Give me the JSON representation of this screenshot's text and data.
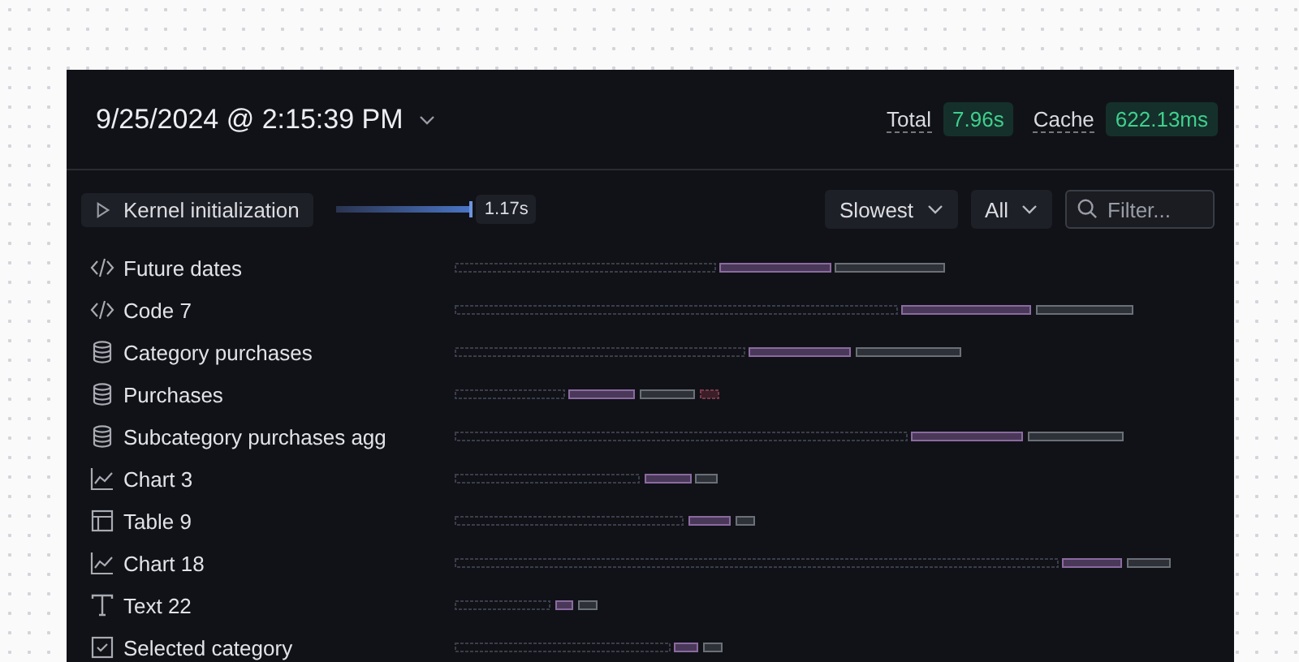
{
  "header": {
    "title": "9/25/2024 @ 2:15:39 PM",
    "stats": [
      {
        "label": "Total",
        "value": "7.96s"
      },
      {
        "label": "Cache",
        "value": "622.13ms"
      }
    ]
  },
  "toolbar": {
    "kernel": {
      "label": "Kernel initialization",
      "duration": "1.17s"
    },
    "sort": "Slowest",
    "filter_kind": "All",
    "search": {
      "placeholder": "Filter..."
    }
  },
  "cells": [
    {
      "kind": "code",
      "name": "Future dates"
    },
    {
      "kind": "code",
      "name": "Code 7"
    },
    {
      "kind": "sql",
      "name": "Category purchases"
    },
    {
      "kind": "sql",
      "name": "Purchases"
    },
    {
      "kind": "sql",
      "name": "Subcategory purchases agg"
    },
    {
      "kind": "chart",
      "name": "Chart 3"
    },
    {
      "kind": "table",
      "name": "Table 9"
    },
    {
      "kind": "chart",
      "name": "Chart 18"
    },
    {
      "kind": "text",
      "name": "Text 22"
    },
    {
      "kind": "input",
      "name": "Selected category"
    }
  ]
}
